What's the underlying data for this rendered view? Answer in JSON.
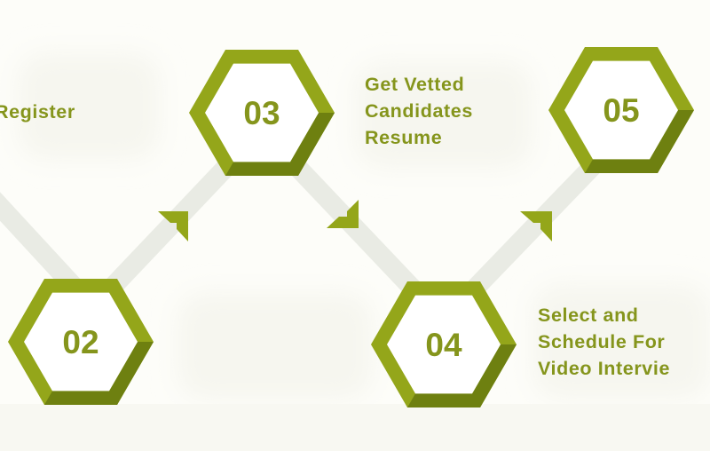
{
  "colors": {
    "accent": "#94a61a",
    "accent_dark": "#6e8010",
    "text": "#85951c",
    "connector": "#e9ebe4",
    "background": "#fdfdf9"
  },
  "steps": [
    {
      "number": "02",
      "label_lines": []
    },
    {
      "number": "03",
      "label_lines": [
        "Get Vetted",
        "Candidates",
        "Resume"
      ]
    },
    {
      "number": "04",
      "label_lines": [
        "Select and",
        "Schedule For",
        "Video Intervie"
      ]
    },
    {
      "number": "05",
      "label_lines": []
    }
  ],
  "previous_step_label": "Register"
}
